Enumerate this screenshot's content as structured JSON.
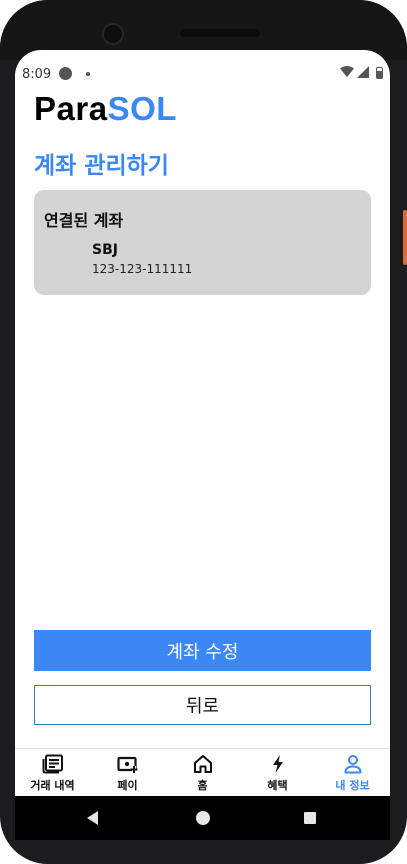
{
  "status_bar": {
    "time": "8:09"
  },
  "logo": {
    "part1": "Para",
    "part2": "SOL"
  },
  "page": {
    "title": "계좌 관리하기"
  },
  "account_card": {
    "heading": "연결된 계좌",
    "bank": "SBJ",
    "account_number": "123-123-111111"
  },
  "actions": {
    "edit_label": "계좌 수정",
    "back_label": "뒤로"
  },
  "bottom_nav": {
    "items": [
      {
        "label": "거래 내역",
        "icon": "receipt-icon"
      },
      {
        "label": "페이",
        "icon": "wallet-plus-icon"
      },
      {
        "label": "홈",
        "icon": "home-icon"
      },
      {
        "label": "혜택",
        "icon": "lightning-icon"
      },
      {
        "label": "내 정보",
        "icon": "person-icon",
        "active": true
      }
    ]
  },
  "colors": {
    "accent": "#3a87f5",
    "card": "#d4d4d4"
  }
}
